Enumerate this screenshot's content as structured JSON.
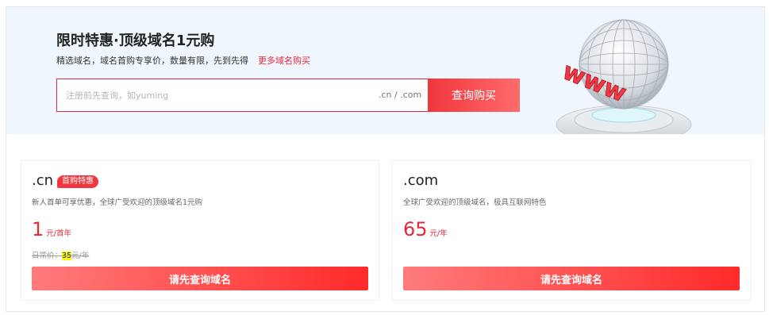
{
  "banner": {
    "title": "限时特惠·顶级域名1元购",
    "subtitle": "精选域名，域名首购专享价，数量有限，先到先得",
    "more_link": "更多域名购买",
    "search_placeholder": "注册前先查询，如yuming",
    "search_suffix": ".cn / .com",
    "search_button": "查询购买",
    "illustration_text": "www"
  },
  "cards": [
    {
      "ext": ".cn",
      "badge": "首购特惠",
      "desc": "新人首单可享优惠，全球广受欢迎的顶级域名1元购",
      "price": "1",
      "unit": "元/首年",
      "orig_prefix": "日常价：",
      "orig_price": "35",
      "orig_unit": "元/年",
      "button": "请先查询域名"
    },
    {
      "ext": ".com",
      "desc": "全球广受欢迎的顶级域名，极具互联网特色",
      "price": "65",
      "unit": "元/年",
      "button": "请先查询域名"
    }
  ],
  "colors": {
    "accent": "#e9283a",
    "banner_bg": "#f0f6fd"
  }
}
